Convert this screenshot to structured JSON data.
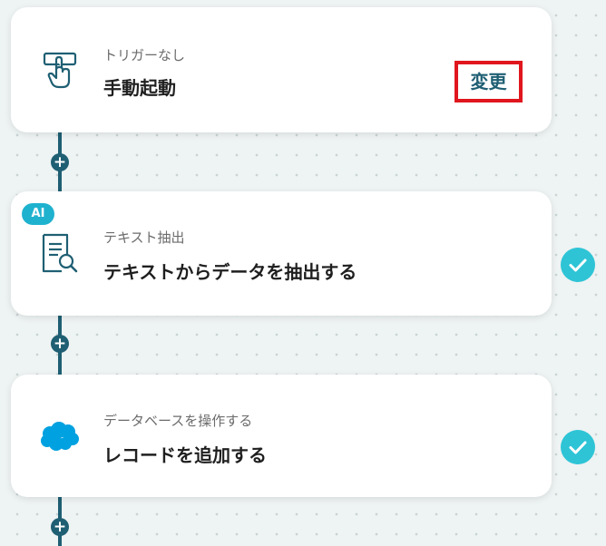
{
  "flow": {
    "steps": [
      {
        "subtitle": "トリガーなし",
        "title": "手動起動",
        "action_label": "変更",
        "icon": "hand-pointer-icon"
      },
      {
        "badge": "AI",
        "subtitle": "テキスト抽出",
        "title": "テキストからデータを抽出する",
        "icon": "document-search-icon",
        "status": "completed"
      },
      {
        "subtitle": "データベースを操作する",
        "title": "レコードを追加する",
        "icon": "salesforce-cloud-icon",
        "status": "completed"
      }
    ],
    "add_label": "+"
  },
  "colors": {
    "accent": "#1f5f73",
    "highlight": "#e0161e",
    "ai_badge": "#1fb2cf",
    "check": "#2ec4d6",
    "salesforce": "#00a1e0"
  }
}
